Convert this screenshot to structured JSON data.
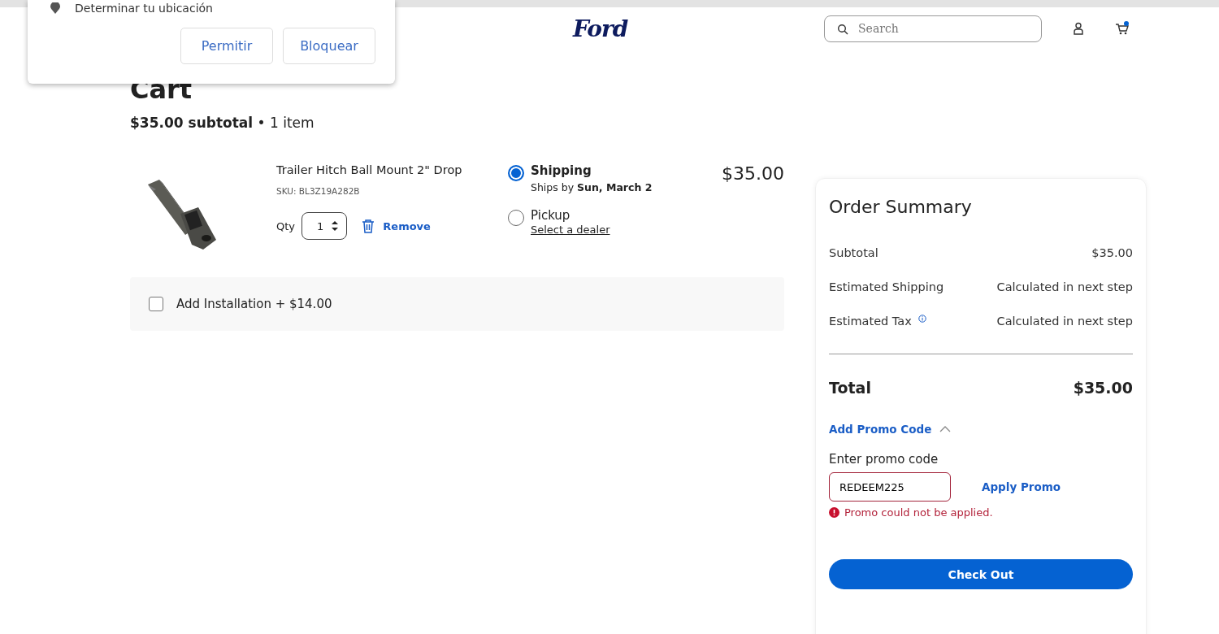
{
  "popup": {
    "message": "Determinar tu ubicación",
    "buttons": [
      "Permitir",
      "Bloquear"
    ]
  },
  "header": {
    "logo": "Ford",
    "search": {
      "placeholder": "Search"
    }
  },
  "cart": {
    "title": "Cart",
    "subtotal": "**$35.00 subtotal** • 1 item"
  },
  "item": {
    "name": "Trailer Hitch Ball Mount 2\" Drop",
    "sku": "SKU: BL3Z19A282B",
    "qty_label": "Qty",
    "qty": "1",
    "remove": "Remove",
    "price": "$35.00",
    "delivery": [
      {
        "label": "Shipping",
        "detail": "Ships by **Sun, March 2**",
        "selected": true
      },
      {
        "label": "Pickup",
        "link": "Select a dealer",
        "selected": false
      }
    ]
  },
  "installation": {
    "label": "Add Installation + $14.00",
    "checked": false
  },
  "summary": {
    "title": "Order Summary",
    "rows": [
      {
        "label": "Subtotal",
        "value": "$35.00",
        "info": false
      },
      {
        "label": "Estimated Shipping",
        "value": "Calculated in next step",
        "info": false
      },
      {
        "label": "Estimated Tax",
        "value": "Calculated in next step",
        "info": true
      }
    ],
    "total_label": "Total",
    "total": "$35.00",
    "promo": {
      "toggle": "Add Promo Code",
      "expanded": true,
      "field_label": "Enter promo code",
      "value": "REDEEM225",
      "apply": "Apply Promo",
      "error": "Promo could not be applied."
    },
    "checkout": "Check Out"
  }
}
